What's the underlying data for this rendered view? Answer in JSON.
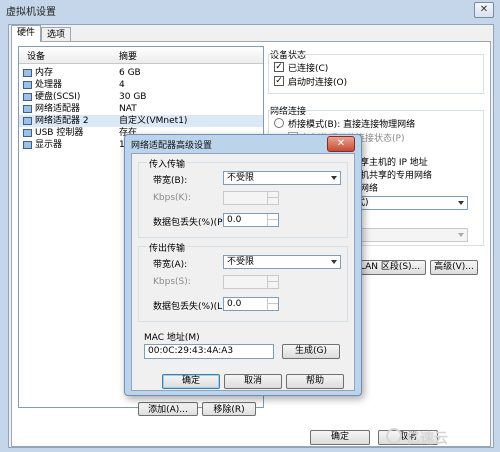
{
  "window": {
    "title": "虚拟机设置",
    "close": "✕"
  },
  "tabs": [
    "硬件",
    "选项"
  ],
  "device_list": {
    "headers": {
      "device": "设备",
      "summary": "摘要"
    },
    "rows": [
      {
        "name": "内存",
        "summary": "6 GB"
      },
      {
        "name": "处理器",
        "summary": "4"
      },
      {
        "name": "硬盘(SCSI)",
        "summary": "30 GB"
      },
      {
        "name": "网络适配器",
        "summary": "NAT"
      },
      {
        "name": "网络适配器 2",
        "summary": "自定义(VMnet1)"
      },
      {
        "name": "USB 控制器",
        "summary": "存在"
      },
      {
        "name": "显示器",
        "summary": "1 个"
      }
    ],
    "add_button": "添加(A)...",
    "remove_button": "移除(R)"
  },
  "device_status": {
    "title": "设备状态",
    "connected": {
      "label": "已连接(C)",
      "checked": true
    },
    "connect_at_power_on": {
      "label": "启动时连接(O)",
      "checked": true
    }
  },
  "network_connection": {
    "title": "网络连接",
    "bridged": "桥接模式(B): 直接连接物理网络",
    "replicate": "复制物理网络连接状态(P)",
    "nat_text": "享主机的 IP 地址",
    "host_only_text": "机共享的专用网络",
    "custom_text": "网络",
    "custom_select": "式)",
    "lan_select": "",
    "lan_segments_button": "LAN 区段(S)...",
    "advanced_button": "高级(V)..."
  },
  "footer": {
    "ok": "确定",
    "cancel": "取消"
  },
  "dialog": {
    "title": "网络适配器高级设置",
    "close": "✕",
    "incoming": {
      "title": "传入传输",
      "bandwidth_label": "带宽(B):",
      "bandwidth_value": "不受限",
      "kbps_label": "Kbps(K):",
      "kbps_value": "",
      "loss_label": "数据包丢失(%)(P)",
      "loss_value": "0.0"
    },
    "outgoing": {
      "title": "传出传输",
      "bandwidth_label": "带宽(A):",
      "bandwidth_value": "不受限",
      "kbps_label": "Kbps(S):",
      "kbps_value": "",
      "loss_label": "数据包丢失(%)(L):",
      "loss_value": "0.0"
    },
    "mac": {
      "label": "MAC 地址(M)",
      "value": "00:0C:29:43:4A:A3",
      "generate_button": "生成(G)"
    },
    "ok": "确定",
    "cancel": "取消",
    "help": "帮助"
  },
  "watermark": "亿速云"
}
